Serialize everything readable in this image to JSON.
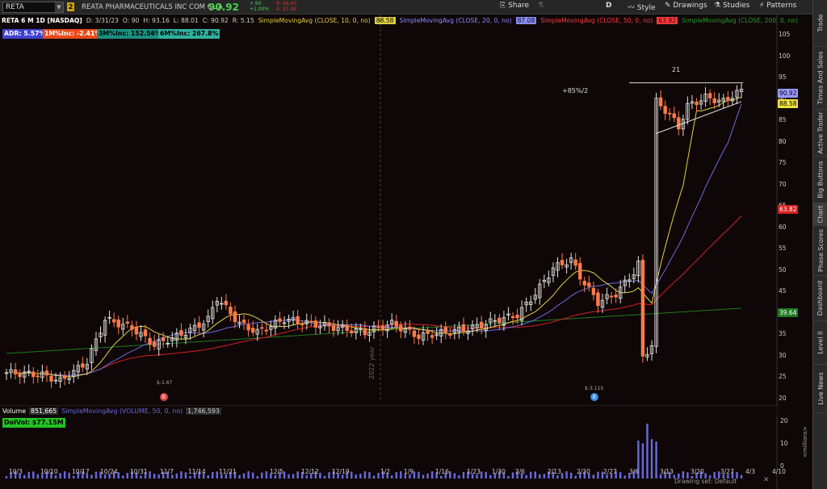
{
  "toolbar": {
    "symbol": "RETA",
    "link_badge": "2",
    "company": "REATA PHARMACEUTICALS INC COM CL A",
    "last": "90.92",
    "change": "+.90",
    "change_pct": "+1.00%",
    "bid": "B: 88.60",
    "ask": "A: 91.88",
    "share": "Share",
    "period": "D",
    "style": "Style",
    "drawings": "Drawings",
    "studies": "Studies",
    "patterns": "Patterns"
  },
  "infobar": {
    "stock": "RETA 6 M 1D [NASDAQ]",
    "date": "D: 3/31/23",
    "open": "O: 90",
    "high": "H: 93.16",
    "low": "L: 88.01",
    "close": "C: 90.92",
    "range": "R: 5.15",
    "sma10": "SimpleMovingAvg (CLOSE, 10, 0, no)",
    "sma10_val": "88.58",
    "sma20": "SimpleMovingAvg (CLOSE, 20, 0, no)",
    "sma20_val": "87.08",
    "sma50": "SimpleMovingAvg (CLOSE, 50, 0, no)",
    "sma50_val": "63.82",
    "sma200": "SimpleMovingAvg (CLOSE, 200, 0, no)"
  },
  "chips": {
    "adr": "ADR: 5.57%",
    "m1": "1M%Inc: -2.41%",
    "m3": "3M%Inc: 152.56%",
    "m6": "6M%Inc: 267.8%"
  },
  "annotations": {
    "pct": "+85%/2",
    "count": "21",
    "year": "2022 year",
    "earn1": "$-1.67",
    "earn2": "$-3.115"
  },
  "price_axis": [
    "105",
    "100",
    "95",
    "90",
    "85",
    "80",
    "75",
    "70",
    "65",
    "60",
    "55",
    "50",
    "45",
    "40",
    "35",
    "30",
    "25",
    "20"
  ],
  "badges": {
    "last": "90.92",
    "sma10": "88.58",
    "sma50": "63.82",
    "sma200": "39.64"
  },
  "dates": [
    "10/3",
    "10/10",
    "10/17",
    "10/24",
    "10/31",
    "11/7",
    "11/14",
    "11/21",
    "12/5",
    "12/12",
    "12/19",
    "1/2",
    "1/9",
    "1/16",
    "1/23",
    "1/30",
    "2/6",
    "2/13",
    "2/20",
    "2/27",
    "3/6",
    "3/13",
    "3/20",
    "3/27",
    "4/3",
    "4/10"
  ],
  "volume": {
    "label": "Volume",
    "value": "851,665",
    "sma": "SimpleMovingAvg (VOLUME, 50, 0, no)",
    "sma_val": "1,746,593",
    "dolvol": "DolVol: $77.15M",
    "axis": [
      "20",
      "10",
      "0"
    ],
    "unit": "<millions>"
  },
  "sidebar": [
    "Trade",
    "Times And Sales",
    "Active Trader",
    "Big Buttons",
    "Chart",
    "Phase Scores",
    "Dashboard",
    "Level II",
    "Live News"
  ],
  "status": "Drawing set: Default",
  "colors": {
    "up": "#e0e0e0",
    "down": "#ff7a4a",
    "sma10": "#e0d040",
    "sma20": "#6a6adf",
    "sma50": "#d42020",
    "sma200": "#2a8a2a"
  }
}
